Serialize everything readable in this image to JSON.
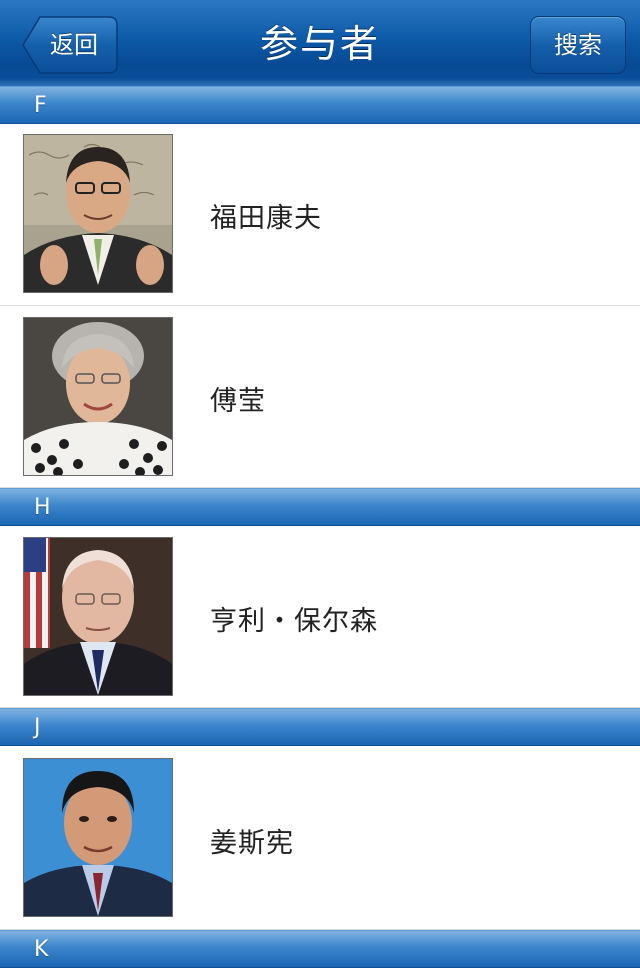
{
  "navbar": {
    "title": "参与者",
    "back_label": "返回",
    "search_label": "搜索"
  },
  "sections": [
    {
      "letter": "F",
      "people": [
        {
          "name": "福田康夫"
        },
        {
          "name": "傅莹"
        }
      ]
    },
    {
      "letter": "H",
      "people": [
        {
          "name": "亨利・保尔森"
        }
      ]
    },
    {
      "letter": "J",
      "people": [
        {
          "name": "姜斯宪"
        }
      ]
    },
    {
      "letter": "K",
      "people": []
    }
  ],
  "colors": {
    "navbar_blue": "#0d5aa8",
    "section_blue": "#3d86cc",
    "name_text": "#222222"
  }
}
